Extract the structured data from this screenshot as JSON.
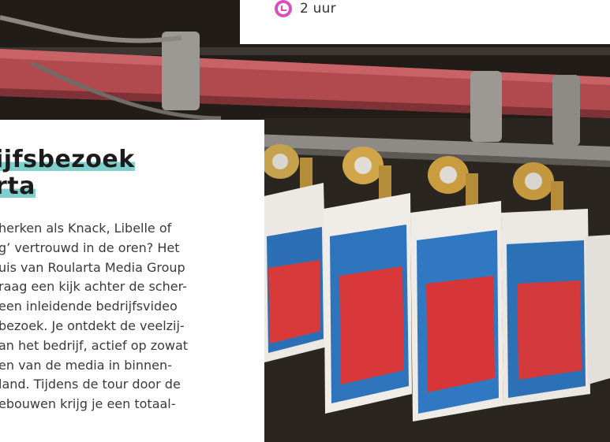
{
  "duration": {
    "icon": "clock-icon",
    "text": "2 uur",
    "icon_color": "#d84fc0"
  },
  "article": {
    "title_line_1": "ijfsbezoek",
    "title_line_2": "rta",
    "highlight_color": "#7fd0cc",
    "body_lines": [
      "herken als Knack, Libelle of",
      "g’ vertrouwd in de oren? Het",
      "uis van Roularta Media Group",
      "raag een kijk achter de scher-",
      "een inleidende bedrijfsvideo",
      "bezoek. Je ontdekt de veelzij-",
      "an het bedrijf, actief op zowat",
      "en van de media in binnen-",
      "land. Tijdens de tour door de",
      "ebouwen krijg je een totaal-"
    ]
  },
  "photo": {
    "subject": "magazines on printing press conveyor"
  }
}
